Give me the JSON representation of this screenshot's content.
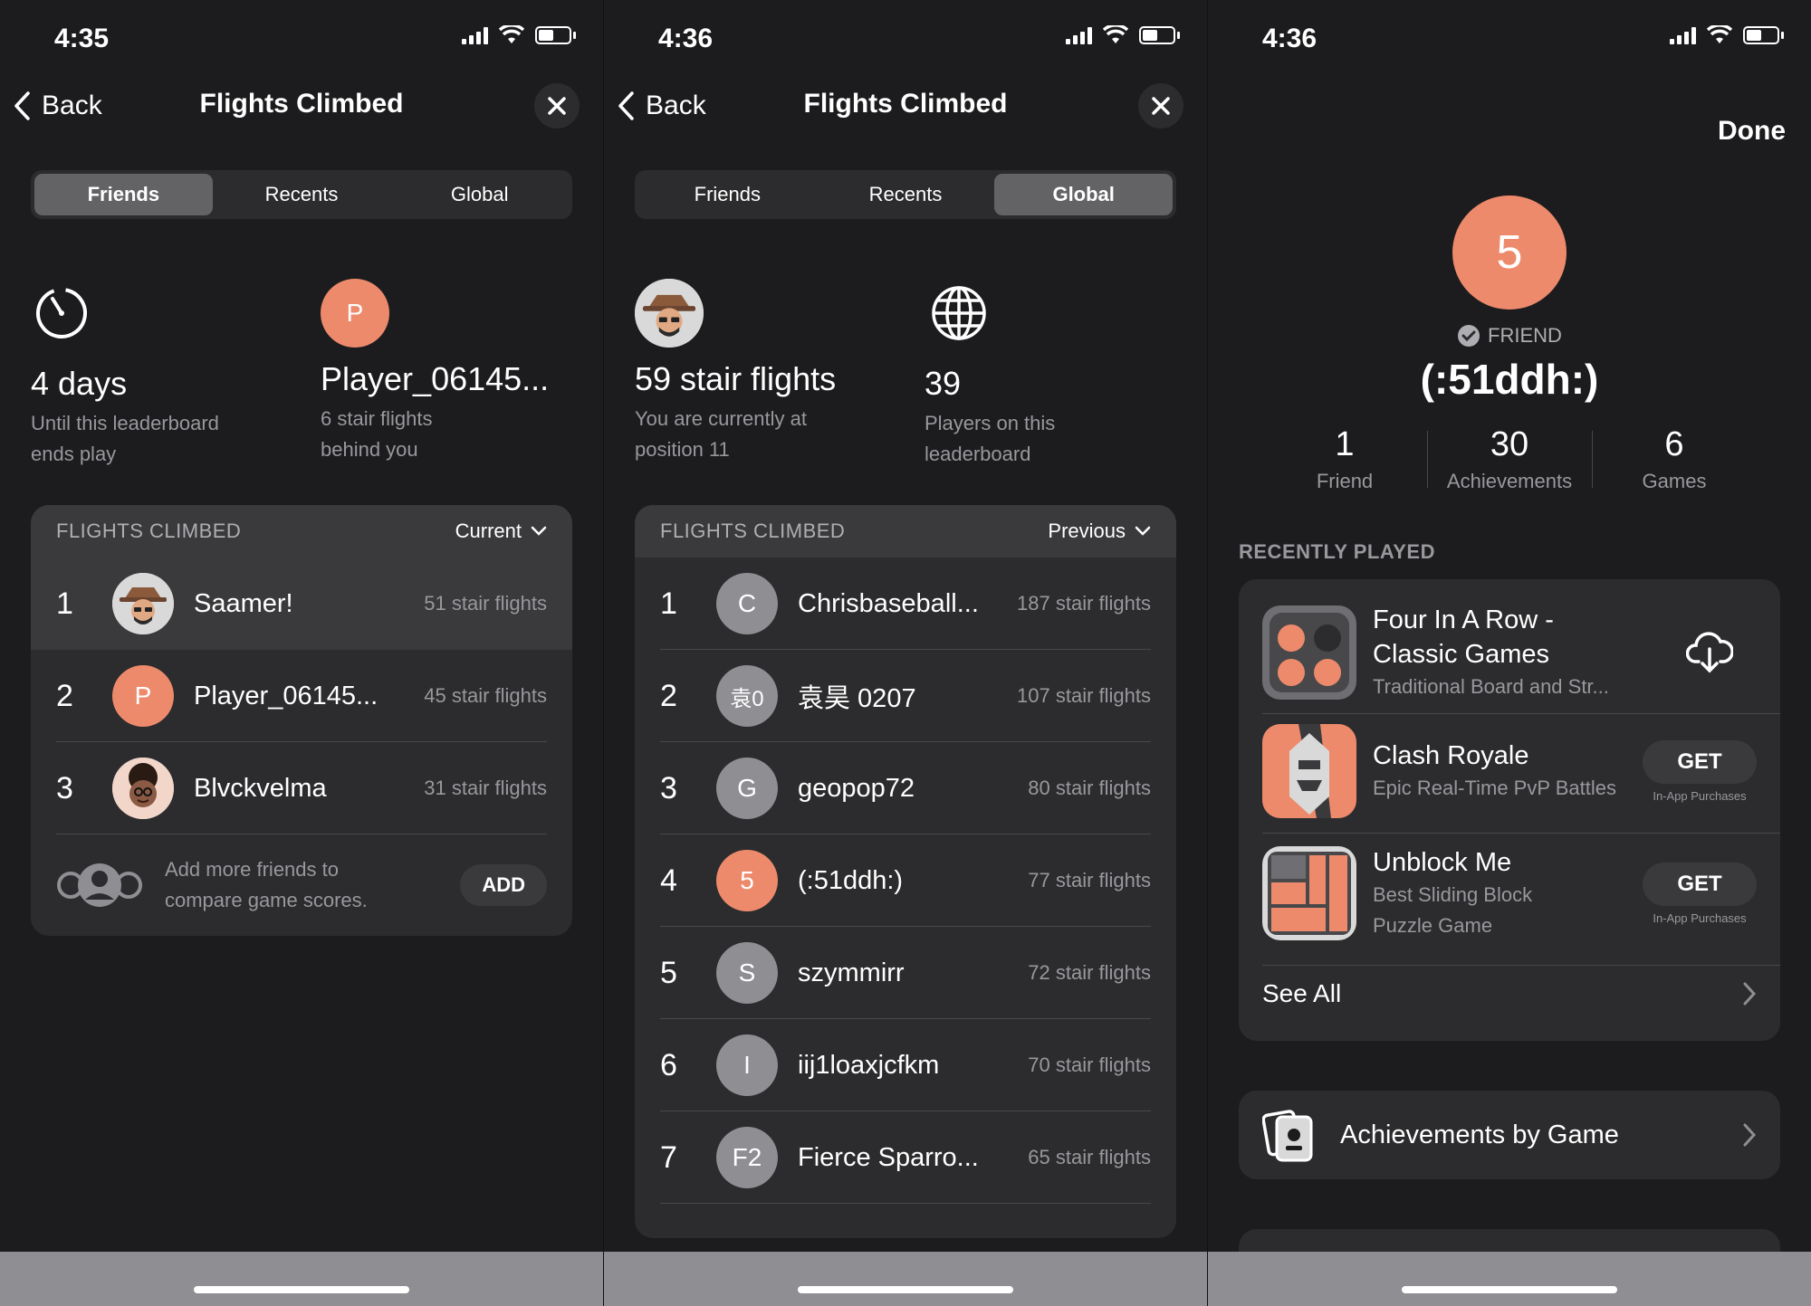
{
  "screens": {
    "s1": {
      "time": "4:35",
      "back_label": "Back",
      "title": "Flights Climbed",
      "tabs": [
        "Friends",
        "Recents",
        "Global"
      ],
      "active_tab": 0,
      "stat_left": {
        "value": "4 days",
        "sub1": "Until this leaderboard",
        "sub2": "ends play"
      },
      "stat_right": {
        "avatar_letter": "P",
        "value": "Player_06145...",
        "sub1": "6 stair flights",
        "sub2": "behind you"
      },
      "board_label": "FLIGHTS CLIMBED",
      "board_period": "Current",
      "rows": [
        {
          "rank": "1",
          "name": "Saamer!",
          "score": "51 stair flights"
        },
        {
          "rank": "2",
          "avatar_letter": "P",
          "name": "Player_06145...",
          "score": "45 stair flights"
        },
        {
          "rank": "3",
          "name": "Blvckvelma",
          "score": "31 stair flights"
        }
      ],
      "add_text1": "Add more friends to",
      "add_text2": "compare game scores.",
      "add_button": "ADD"
    },
    "s2": {
      "time": "4:36",
      "back_label": "Back",
      "title": "Flights Climbed",
      "tabs": [
        "Friends",
        "Recents",
        "Global"
      ],
      "active_tab": 2,
      "stat_left": {
        "value": "59 stair flights",
        "sub1": "You are currently at",
        "sub2": "position 11"
      },
      "stat_right": {
        "value": "39",
        "sub1": "Players on this",
        "sub2": "leaderboard"
      },
      "board_label": "FLIGHTS CLIMBED",
      "board_period": "Previous",
      "rows": [
        {
          "rank": "1",
          "avatar_letter": "C",
          "name": "Chrisbaseball...",
          "score": "187 stair flights"
        },
        {
          "rank": "2",
          "avatar_letter": "袁0",
          "name": "袁昊 0207",
          "score": "107 stair flights"
        },
        {
          "rank": "3",
          "avatar_letter": "G",
          "name": "geopop72",
          "score": "80 stair flights"
        },
        {
          "rank": "4",
          "avatar_letter": "5",
          "name": "(:51ddh:)",
          "score": "77 stair flights"
        },
        {
          "rank": "5",
          "avatar_letter": "S",
          "name": "szymmirr",
          "score": "72 stair flights"
        },
        {
          "rank": "6",
          "avatar_letter": "I",
          "name": "iij1loaxjcfkm",
          "score": "70 stair flights"
        },
        {
          "rank": "7",
          "avatar_letter": "F2",
          "name": "Fierce Sparro...",
          "score": "65 stair flights"
        }
      ]
    },
    "s3": {
      "time": "4:36",
      "done_label": "Done",
      "avatar_letter": "5",
      "friend_tag": "FRIEND",
      "name": "(:51ddh:)",
      "stats": [
        {
          "n": "1",
          "l": "Friend"
        },
        {
          "n": "30",
          "l": "Achievements"
        },
        {
          "n": "6",
          "l": "Games"
        }
      ],
      "section_label": "RECENTLY PLAYED",
      "games": [
        {
          "title1": "Four In A Row -",
          "title2": "Classic Games",
          "sub": "Traditional Board and Str..."
        },
        {
          "title1": "Clash Royale",
          "sub": "Epic Real-Time PvP Battles",
          "button": "GET",
          "iap": "In-App Purchases"
        },
        {
          "title1": "Unblock Me",
          "sub1": "Best Sliding Block",
          "sub2": "Puzzle Game",
          "button": "GET",
          "iap": "In-App Purchases"
        }
      ],
      "see_all": "See All",
      "achievements_label": "Achievements by Game"
    }
  },
  "colors": {
    "accent": "#ee8a6c",
    "background": "#1c1c1e",
    "card": "#2c2c2e",
    "secondary_text": "#98989d"
  },
  "icons": [
    "timer-icon",
    "globe-icon",
    "cloud-download-icon",
    "chevron-right-icon",
    "chevron-down-icon",
    "close-icon",
    "back-chevron-icon",
    "checkmark-seal-icon",
    "achievement-book-icon",
    "friends-group-icon"
  ]
}
